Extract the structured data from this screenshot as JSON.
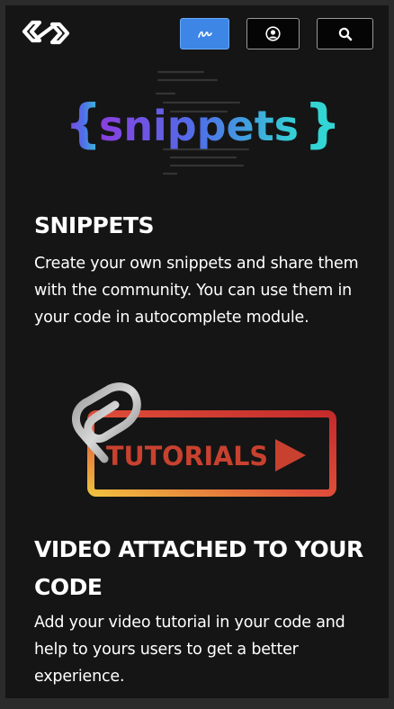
{
  "header": {
    "logo_icon": "link-logo-icon",
    "sign_button_icon": "signature-icon",
    "user_button_icon": "user-circle-icon",
    "search_button_icon": "search-icon",
    "accent_color": "#3d86e6"
  },
  "hero": {
    "open_brace": "{",
    "word": "snippets",
    "close_brace": "}",
    "gradient_colors": [
      "#8a3fe0",
      "#4f6fe8",
      "#33d4d4"
    ]
  },
  "sections": [
    {
      "title": "SNIPPETS",
      "text": "Create your own snippets and share them with the community. You can use them in your code in autocomplete module."
    },
    {
      "title": "VIDEO ATTACHED TO YOUR CODE",
      "text": "Add your video tutorial in your code and help to yours users to get a better experience."
    }
  ],
  "tutorials_graphic": {
    "label": "TUTORIALS",
    "icons": [
      "paperclip-icon",
      "play-icon"
    ],
    "gradient_colors": [
      "#f0c040",
      "#e0503a",
      "#c42b2b"
    ]
  }
}
